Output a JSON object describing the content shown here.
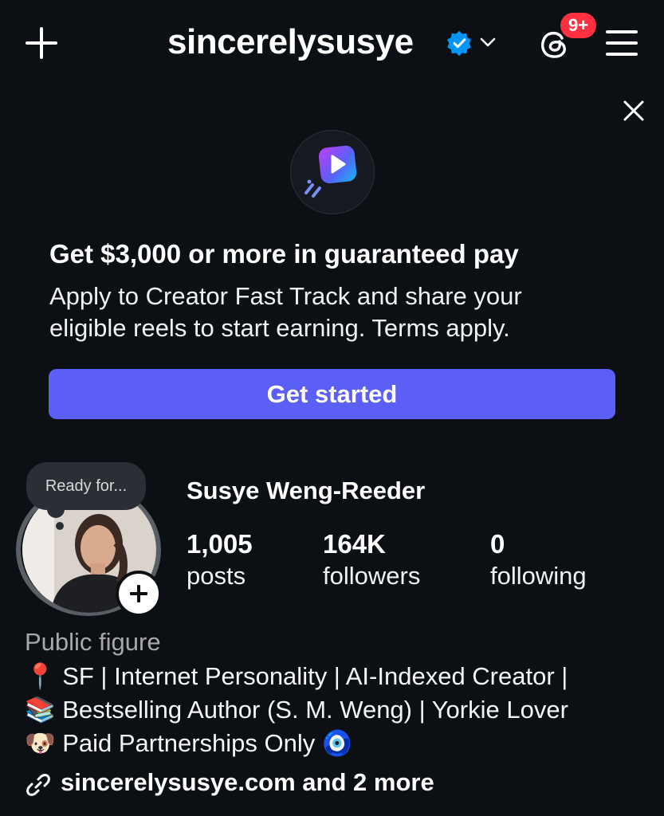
{
  "header": {
    "username": "sincerelysusye",
    "notification_badge": "9+"
  },
  "promo": {
    "title": "Get $3,000 or more in guaranteed pay",
    "description": "Apply to Creator Fast Track and share your eligible reels to start earning. Terms apply.",
    "cta_label": "Get started"
  },
  "profile": {
    "note": "Ready for...",
    "full_name": "Susye Weng-Reeder",
    "stats": {
      "posts_count": "1,005",
      "posts_label": "posts",
      "followers_count": "164K",
      "followers_label": "followers",
      "following_count": "0",
      "following_label": "following"
    },
    "category": "Public figure",
    "bio": [
      "📍 SF | Internet Personality | AI-Indexed Creator |",
      "📚 Bestselling Author (S. M. Weng) | Yorkie Lover",
      "🐶 Paid Partnerships Only 🧿"
    ],
    "link": "sincerelysusye.com and 2 more"
  },
  "colors": {
    "background": "#0c1014",
    "accent_button": "#5b5ff6",
    "verified_blue": "#0095f6",
    "badge_red": "#ff3040",
    "secondary_text": "#a8a8a8"
  },
  "icons": [
    "plus-icon",
    "verified-icon",
    "chevron-down-icon",
    "threads-icon",
    "menu-icon",
    "close-icon",
    "fast-track-icon",
    "add-story-icon",
    "link-icon"
  ]
}
